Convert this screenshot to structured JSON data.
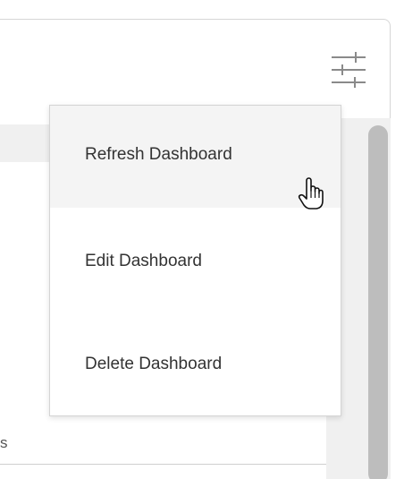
{
  "panel": {
    "settings_icon": "sliders-icon",
    "partial_row_text": "s"
  },
  "menu": {
    "items": [
      {
        "label": "Refresh Dashboard",
        "hovered": true
      },
      {
        "label": "Edit Dashboard",
        "hovered": false
      },
      {
        "label": "Delete Dashboard",
        "hovered": false
      }
    ]
  },
  "cursor": {
    "type": "hand-pointer-icon"
  },
  "colors": {
    "menu_hover_bg": "#f4f4f4",
    "text": "#333333",
    "header_bg": "#f0f0f0",
    "scroll_thumb": "#bdbdbd"
  }
}
